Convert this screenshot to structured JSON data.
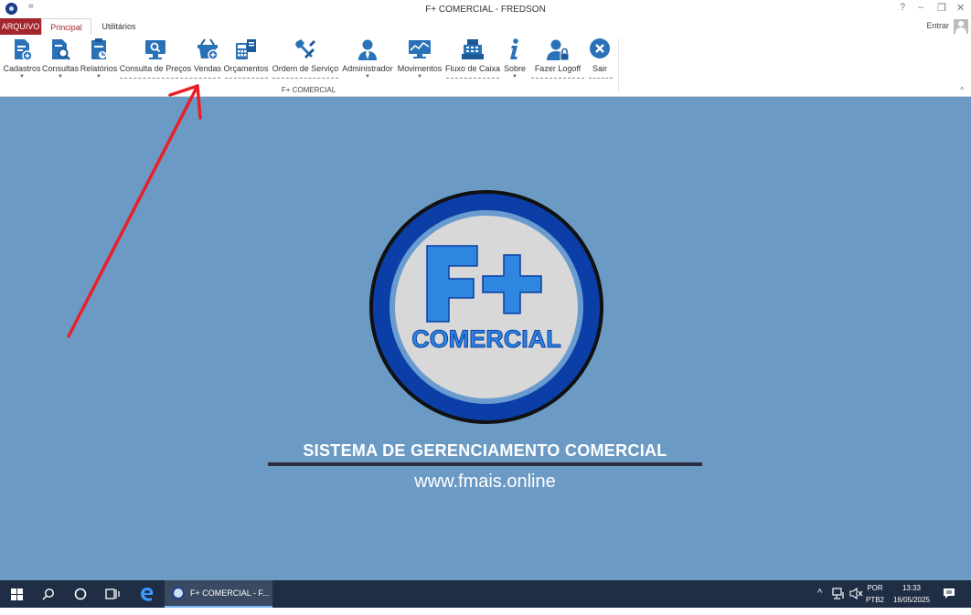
{
  "window": {
    "title": "F+ COMERCIAL - FREDSON",
    "qat_symbol": "=",
    "controls": {
      "help": "?",
      "minimize": "–",
      "restore": "❐",
      "close": "✕"
    }
  },
  "tabs": {
    "arquivo": "ARQUIVO",
    "principal": "Principal",
    "utilitarios": "Utilitários",
    "entrar": "Entrar"
  },
  "ribbon": {
    "group_label": "F+ COMERCIAL",
    "collapse_symbol": "^",
    "buttons": [
      {
        "label": "Cadastros",
        "icon": "cadastros-icon",
        "dropdown": true
      },
      {
        "label": "Consultas",
        "icon": "consultas-icon",
        "dropdown": true
      },
      {
        "label": "Relatórios",
        "icon": "relatorios-icon",
        "dropdown": true
      },
      {
        "label": "Consulta de Preços",
        "icon": "price-monitor-icon",
        "dropdown": false
      },
      {
        "label": "Vendas",
        "icon": "shopping-basket-icon",
        "dropdown": false
      },
      {
        "label": "Orçamentos",
        "icon": "calculator-icon",
        "dropdown": false
      },
      {
        "label": "Ordem de Serviço",
        "icon": "tools-icon",
        "dropdown": false
      },
      {
        "label": "Administrador",
        "icon": "admin-user-icon",
        "dropdown": true
      },
      {
        "label": "Movimentos",
        "icon": "chart-monitor-icon",
        "dropdown": true
      },
      {
        "label": "Fluxo de Caixa",
        "icon": "cash-register-icon",
        "dropdown": false
      },
      {
        "label": "Sobre",
        "icon": "info-icon",
        "dropdown": true
      },
      {
        "label": "Fazer Logoff",
        "icon": "user-lock-icon",
        "dropdown": false
      },
      {
        "label": "Sair",
        "icon": "exit-icon",
        "dropdown": false
      }
    ]
  },
  "main": {
    "logo_big": "F+",
    "logo_text": "COMERCIAL",
    "slogan": "SISTEMA DE GERENCIAMENTO COMERCIAL",
    "url": "www.fmais.online",
    "background_color": "#6b9bc4"
  },
  "taskbar": {
    "app_label": "F+ COMERCIAL - F...",
    "lang_top": "POR",
    "lang_bottom": "PTB2",
    "time": "13:33",
    "date": "16/05/2025"
  },
  "colors": {
    "accent_red": "#a4262c",
    "icon_blue": "#2a72b8",
    "logo_ring": "#0b3ea6",
    "logo_letters": "#2e86de",
    "annotation_arrow": "#e8202a"
  }
}
